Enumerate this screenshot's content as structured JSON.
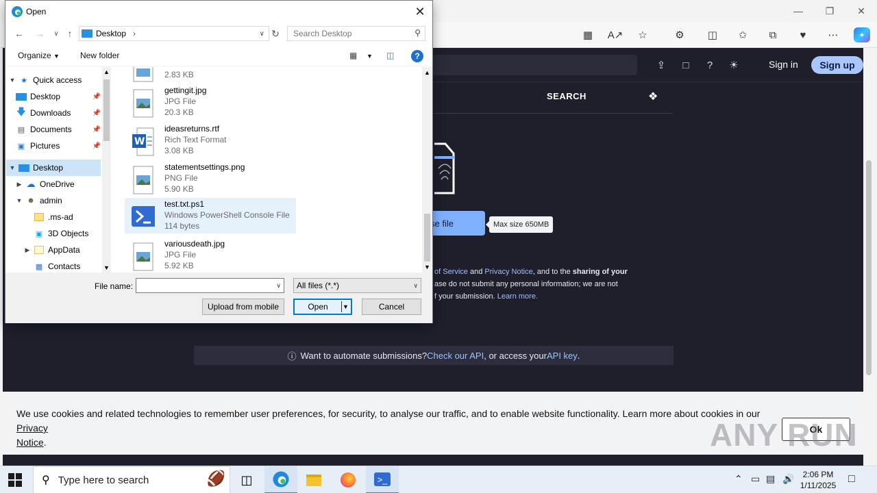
{
  "dialog": {
    "title": "Open",
    "address": "Desktop",
    "search_placeholder": "Search Desktop",
    "organize_label": "Organize",
    "new_folder_label": "New folder",
    "nav_items": [
      {
        "label": "Quick access",
        "icon": "star-icon"
      },
      {
        "label": "Desktop",
        "icon": "desktop-icon"
      },
      {
        "label": "Downloads",
        "icon": "download-icon"
      },
      {
        "label": "Documents",
        "icon": "document-icon"
      },
      {
        "label": "Pictures",
        "icon": "picture-icon"
      },
      {
        "label": "Desktop",
        "icon": "desktop-icon"
      },
      {
        "label": "OneDrive",
        "icon": "cloud-icon"
      },
      {
        "label": "admin",
        "icon": "user-icon"
      },
      {
        "label": ".ms-ad",
        "icon": "folder-icon"
      },
      {
        "label": "3D Objects",
        "icon": "cube-icon"
      },
      {
        "label": "AppData",
        "icon": "folder-icon"
      },
      {
        "label": "Contacts",
        "icon": "contacts-icon"
      }
    ],
    "files": [
      {
        "name": "",
        "type": "",
        "size": "2.83 KB",
        "icon": "image-file-icon"
      },
      {
        "name": "gettingit.jpg",
        "type": "JPG File",
        "size": "20.3 KB",
        "icon": "image-file-icon"
      },
      {
        "name": "ideasreturns.rtf",
        "type": "Rich Text Format",
        "size": "3.08 KB",
        "icon": "word-file-icon"
      },
      {
        "name": "statementsettings.png",
        "type": "PNG File",
        "size": "5.90 KB",
        "icon": "image-file-icon"
      },
      {
        "name": "test.txt.ps1",
        "type": "Windows PowerShell Console File",
        "size": "114 bytes",
        "icon": "powershell-file-icon"
      },
      {
        "name": "variousdeath.jpg",
        "type": "JPG File",
        "size": "5.92 KB",
        "icon": "image-file-icon"
      }
    ],
    "file_name_label": "File name:",
    "file_name_value": "",
    "file_type": "All files (*.*)",
    "upload_mobile_label": "Upload from mobile",
    "open_label": "Open",
    "cancel_label": "Cancel"
  },
  "site": {
    "signin": "Sign in",
    "signup": "Sign up",
    "tab_search": "SEARCH",
    "upload_partial": "se file",
    "max_size": "Max size 650MB",
    "terms_line1_a": "of Service",
    "terms_line1_b": " and ",
    "terms_line1_c": "Privacy Notice",
    "terms_line1_d": ", and to the ",
    "terms_line1_e": "sharing of your",
    "terms_line2": "ase do not submit any personal information; we are not",
    "terms_line3_a": "f your submission. ",
    "terms_line3_b": "Learn more.",
    "api_text_a": "Want to automate submissions? ",
    "api_link_1": "Check our API",
    "api_text_b": ", or access your ",
    "api_link_2": "API key",
    "api_text_c": ".",
    "cookie_text": "We use cookies and related technologies to remember user preferences, for security, to analyse our traffic, and to enable website functionality. Learn more about cookies in our ",
    "cookie_link_a": "Privacy",
    "cookie_link_b": "Notice",
    "cookie_end": ".",
    "ok_label": "Ok",
    "watermark": "ANY RUN"
  },
  "taskbar": {
    "search_placeholder": "Type here to search",
    "time": "2:06 PM",
    "date": "1/11/2025"
  },
  "colors": {
    "accent": "#0078d7",
    "site_bg": "#1e1f2b",
    "link": "#9cc0ff",
    "signup_bg": "#a9c6ff"
  }
}
